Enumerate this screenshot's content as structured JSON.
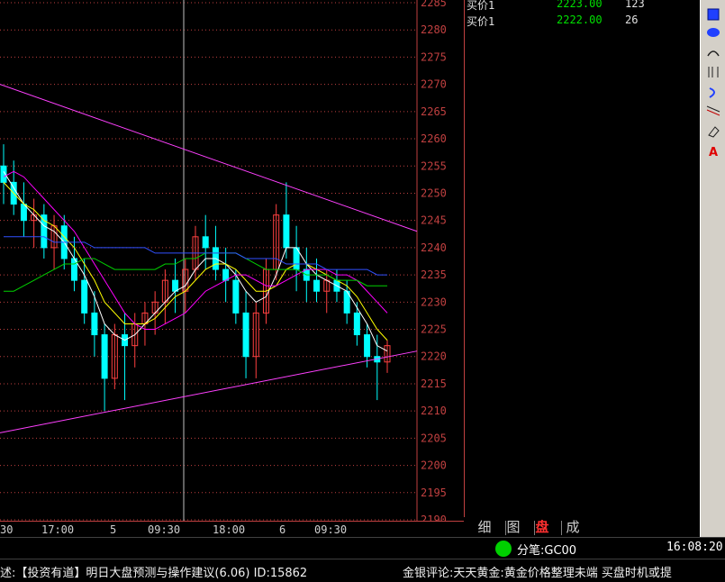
{
  "chart_data": {
    "type": "candlestick",
    "symbol": "GC00",
    "ylim": [
      2190,
      2285
    ],
    "y_ticks": [
      2190,
      2195,
      2200,
      2205,
      2210,
      2215,
      2220,
      2225,
      2230,
      2235,
      2240,
      2245,
      2250,
      2255,
      2260,
      2265,
      2270,
      2275,
      2280,
      2285
    ],
    "x_labels": [
      "30",
      "17:00",
      "5",
      "09:30",
      "18:00",
      "6",
      "09:30"
    ],
    "candles": [
      {
        "o": 2255,
        "h": 2259,
        "l": 2248,
        "c": 2252
      },
      {
        "o": 2252,
        "h": 2256,
        "l": 2246,
        "c": 2248
      },
      {
        "o": 2248,
        "h": 2252,
        "l": 2242,
        "c": 2245
      },
      {
        "o": 2245,
        "h": 2249,
        "l": 2240,
        "c": 2246
      },
      {
        "o": 2246,
        "h": 2248,
        "l": 2238,
        "c": 2240
      },
      {
        "o": 2240,
        "h": 2246,
        "l": 2236,
        "c": 2244
      },
      {
        "o": 2244,
        "h": 2246,
        "l": 2236,
        "c": 2238
      },
      {
        "o": 2238,
        "h": 2242,
        "l": 2232,
        "c": 2234
      },
      {
        "o": 2234,
        "h": 2238,
        "l": 2226,
        "c": 2228
      },
      {
        "o": 2228,
        "h": 2232,
        "l": 2220,
        "c": 2224
      },
      {
        "o": 2224,
        "h": 2226,
        "l": 2210,
        "c": 2216
      },
      {
        "o": 2216,
        "h": 2226,
        "l": 2214,
        "c": 2224
      },
      {
        "o": 2224,
        "h": 2228,
        "l": 2212,
        "c": 2222
      },
      {
        "o": 2222,
        "h": 2228,
        "l": 2218,
        "c": 2226
      },
      {
        "o": 2226,
        "h": 2230,
        "l": 2222,
        "c": 2228
      },
      {
        "o": 2228,
        "h": 2232,
        "l": 2224,
        "c": 2230
      },
      {
        "o": 2230,
        "h": 2236,
        "l": 2226,
        "c": 2234
      },
      {
        "o": 2234,
        "h": 2238,
        "l": 2228,
        "c": 2232
      },
      {
        "o": 2232,
        "h": 2238,
        "l": 2228,
        "c": 2236
      },
      {
        "o": 2236,
        "h": 2244,
        "l": 2234,
        "c": 2242
      },
      {
        "o": 2242,
        "h": 2246,
        "l": 2236,
        "c": 2240
      },
      {
        "o": 2240,
        "h": 2244,
        "l": 2234,
        "c": 2236
      },
      {
        "o": 2236,
        "h": 2240,
        "l": 2230,
        "c": 2234
      },
      {
        "o": 2234,
        "h": 2236,
        "l": 2226,
        "c": 2228
      },
      {
        "o": 2228,
        "h": 2232,
        "l": 2216,
        "c": 2220
      },
      {
        "o": 2220,
        "h": 2230,
        "l": 2216,
        "c": 2228
      },
      {
        "o": 2228,
        "h": 2238,
        "l": 2226,
        "c": 2236
      },
      {
        "o": 2236,
        "h": 2248,
        "l": 2234,
        "c": 2246
      },
      {
        "o": 2246,
        "h": 2252,
        "l": 2238,
        "c": 2240
      },
      {
        "o": 2240,
        "h": 2244,
        "l": 2232,
        "c": 2236
      },
      {
        "o": 2236,
        "h": 2240,
        "l": 2230,
        "c": 2234
      },
      {
        "o": 2234,
        "h": 2238,
        "l": 2230,
        "c": 2232
      },
      {
        "o": 2232,
        "h": 2236,
        "l": 2228,
        "c": 2234
      },
      {
        "o": 2234,
        "h": 2236,
        "l": 2230,
        "c": 2232
      },
      {
        "o": 2232,
        "h": 2234,
        "l": 2226,
        "c": 2228
      },
      {
        "o": 2228,
        "h": 2230,
        "l": 2222,
        "c": 2224
      },
      {
        "o": 2224,
        "h": 2226,
        "l": 2218,
        "c": 2220
      },
      {
        "o": 2220,
        "h": 2224,
        "l": 2212,
        "c": 2219
      },
      {
        "o": 2219,
        "h": 2223,
        "l": 2217,
        "c": 2222
      }
    ],
    "ma_series": [
      {
        "color": "#ffffff",
        "values": [
          2254,
          2251,
          2248,
          2246,
          2244,
          2243,
          2241,
          2238,
          2235,
          2231,
          2226,
          2224,
          2223,
          2224,
          2226,
          2228,
          2230,
          2232,
          2233,
          2236,
          2238,
          2238,
          2237,
          2235,
          2232,
          2230,
          2231,
          2235,
          2240,
          2240,
          2237,
          2235,
          2234,
          2233,
          2232,
          2229,
          2226,
          2222,
          2221
        ]
      },
      {
        "color": "#ffff00",
        "values": [
          2252,
          2250,
          2248,
          2247,
          2245,
          2244,
          2242,
          2240,
          2237,
          2234,
          2230,
          2228,
          2226,
          2226,
          2226,
          2227,
          2229,
          2231,
          2232,
          2234,
          2236,
          2237,
          2237,
          2236,
          2234,
          2232,
          2232,
          2233,
          2236,
          2237,
          2237,
          2236,
          2235,
          2234,
          2233,
          2231,
          2228,
          2225,
          2223
        ]
      },
      {
        "color": "#ff00ff",
        "values": [
          2253,
          2254,
          2253,
          2251,
          2249,
          2247,
          2245,
          2243,
          2240,
          2237,
          2234,
          2231,
          2228,
          2226,
          2225,
          2225,
          2226,
          2227,
          2228,
          2230,
          2232,
          2233,
          2234,
          2235,
          2235,
          2234,
          2233,
          2233,
          2234,
          2235,
          2236,
          2236,
          2236,
          2235,
          2235,
          2234,
          2232,
          2230,
          2228
        ]
      },
      {
        "color": "#00d000",
        "values": [
          2232,
          2232,
          2233,
          2234,
          2235,
          2236,
          2237,
          2237,
          2238,
          2238,
          2237,
          2236,
          2236,
          2236,
          2236,
          2236,
          2237,
          2237,
          2238,
          2238,
          2239,
          2239,
          2239,
          2239,
          2238,
          2237,
          2236,
          2236,
          2236,
          2236,
          2235,
          2235,
          2235,
          2234,
          2234,
          2234,
          2233,
          2233,
          2233
        ]
      },
      {
        "color": "#3050ff",
        "values": [
          2242,
          2242,
          2242,
          2242,
          2242,
          2241,
          2241,
          2241,
          2241,
          2240,
          2240,
          2240,
          2240,
          2240,
          2240,
          2239,
          2239,
          2239,
          2239,
          2239,
          2239,
          2239,
          2239,
          2239,
          2238,
          2238,
          2238,
          2238,
          2237,
          2237,
          2237,
          2237,
          2236,
          2236,
          2236,
          2236,
          2236,
          2235,
          2235
        ]
      }
    ],
    "trend_lines": [
      {
        "color": "#ff40ff",
        "from": [
          0,
          2270
        ],
        "to": [
          1.0,
          2243
        ]
      },
      {
        "color": "#ff40ff",
        "from": [
          0,
          2206
        ],
        "to": [
          1.0,
          2221
        ]
      }
    ]
  },
  "quotes": [
    {
      "label": "买价1",
      "price": "2223.00",
      "volume": "123"
    },
    {
      "label": "买价1",
      "price": "2222.00",
      "volume": "26"
    }
  ],
  "panel_tabs": [
    {
      "label": "细"
    },
    {
      "label": "图"
    },
    {
      "label": "盘"
    },
    {
      "label": "成"
    }
  ],
  "status": {
    "code": "分笔:GC00",
    "time": "16:08:20"
  },
  "ticker": {
    "item1": "述:【投资有道】明日大盘预测与操作建议(6.06)   ID:15862",
    "item2": "金银评论:天天黄金:黄金价格整理未端 买盘时机或提"
  },
  "colors": {
    "up": "#ff4040",
    "down": "#00ffff",
    "grid": "#c04040",
    "axis_text": "#c04040"
  },
  "tools": [
    "rect-icon",
    "ellipse-icon",
    "arc-icon",
    "fibonacci-icon",
    "cycle-icon",
    "channel-icon",
    "eraser-icon",
    "text-icon"
  ]
}
